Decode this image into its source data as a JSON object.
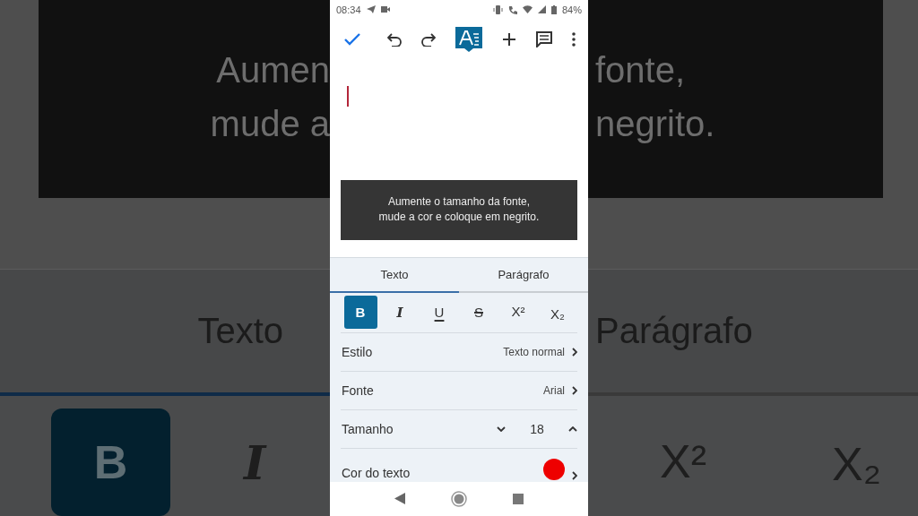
{
  "backdrop": {
    "left": {
      "caption": [
        "Aumen",
        "mude a"
      ],
      "tab": {
        "label": "Texto",
        "selected": true
      },
      "buttons": [
        {
          "label": "B",
          "kind": "bold",
          "selected": true
        },
        {
          "label": "I",
          "kind": "italic",
          "selected": false
        }
      ]
    },
    "right": {
      "caption": [
        "fonte,",
        "negrito."
      ],
      "tab": {
        "label": "Parágrafo",
        "selected": false
      },
      "buttons": [
        {
          "label": "X²",
          "kind": "sup",
          "selected": false
        },
        {
          "label": "X₂",
          "kind": "sub",
          "selected": false
        }
      ]
    }
  },
  "status_bar": {
    "time": "08:34",
    "battery": "84%"
  },
  "document": {
    "caption": [
      "Aumente o tamanho da fonte,",
      "mude a cor e coloque em negrito."
    ]
  },
  "tabs": [
    {
      "label": "Texto",
      "selected": true
    },
    {
      "label": "Parágrafo",
      "selected": false
    }
  ],
  "format_buttons": [
    {
      "label": "B",
      "kind": "bold",
      "selected": true
    },
    {
      "label": "I",
      "kind": "italic",
      "selected": false
    },
    {
      "label": "U",
      "kind": "underline",
      "selected": false
    },
    {
      "label": "S",
      "kind": "strike",
      "selected": false
    },
    {
      "label": "X²",
      "kind": "sup",
      "selected": false
    },
    {
      "label": "X₂",
      "kind": "sub",
      "selected": false
    }
  ],
  "settings": [
    {
      "kind": "link",
      "label": "Estilo",
      "value": "Texto normal"
    },
    {
      "kind": "link",
      "label": "Fonte",
      "value": "Arial"
    },
    {
      "kind": "stepper",
      "label": "Tamanho",
      "value": "18"
    },
    {
      "kind": "color",
      "label": "Cor do texto",
      "color": "#ee0000"
    }
  ]
}
